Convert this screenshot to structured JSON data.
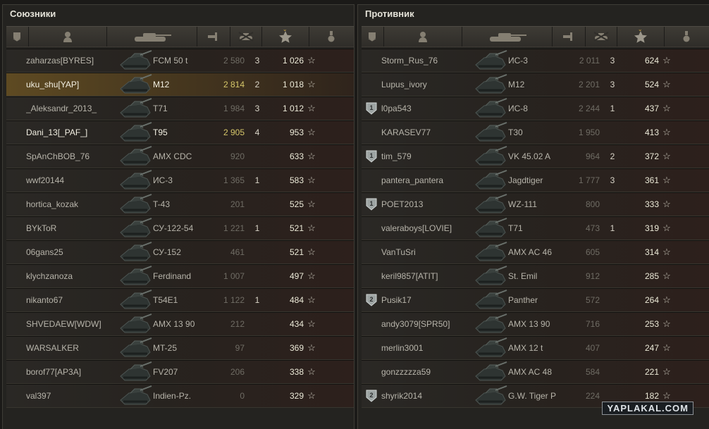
{
  "allies": {
    "title": "Союзники",
    "players": [
      {
        "name": "zaharzas[BYRES]",
        "tank": "FCM 50 t",
        "damage": "2 580",
        "kills": "3",
        "xp": "1 026"
      },
      {
        "name": "uku_shu[YAP]",
        "tank": "M12",
        "damage": "2 814",
        "kills": "2",
        "xp": "1 018"
      },
      {
        "name": "_Aleksandr_2013_",
        "tank": "T71",
        "damage": "1 984",
        "kills": "3",
        "xp": "1 012"
      },
      {
        "name": "Dani_13[_PAF_]",
        "tank": "T95",
        "damage": "2 905",
        "kills": "4",
        "xp": "953"
      },
      {
        "name": "SpAnChBOB_76",
        "tank": "AMX CDC",
        "damage": "920",
        "kills": "",
        "xp": "633"
      },
      {
        "name": "wwf20144",
        "tank": "ИС-3",
        "damage": "1 365",
        "kills": "1",
        "xp": "583"
      },
      {
        "name": "hortica_kozak",
        "tank": "T-43",
        "damage": "201",
        "kills": "",
        "xp": "525"
      },
      {
        "name": "BYkToR",
        "tank": "СУ-122-54",
        "damage": "1 221",
        "kills": "1",
        "xp": "521"
      },
      {
        "name": "06gans25",
        "tank": "СУ-152",
        "damage": "461",
        "kills": "",
        "xp": "521"
      },
      {
        "name": "klychzanoza",
        "tank": "Ferdinand",
        "damage": "1 007",
        "kills": "",
        "xp": "497"
      },
      {
        "name": "nikanto67",
        "tank": "T54E1",
        "damage": "1 122",
        "kills": "1",
        "xp": "484"
      },
      {
        "name": "SHVEDAEW[WDW]",
        "tank": "AMX 13 90",
        "damage": "212",
        "kills": "",
        "xp": "434"
      },
      {
        "name": "WARSALKER",
        "tank": "MT-25",
        "damage": "97",
        "kills": "",
        "xp": "369"
      },
      {
        "name": "borof77[AP3A]",
        "tank": "FV207",
        "damage": "206",
        "kills": "",
        "xp": "338"
      },
      {
        "name": "val397",
        "tank": "Indien-Pz.",
        "damage": "0",
        "kills": "",
        "xp": "329"
      }
    ]
  },
  "enemies": {
    "title": "Противник",
    "players": [
      {
        "name": "Storm_Rus_76",
        "tank": "ИС-3",
        "damage": "2 011",
        "kills": "3",
        "xp": "624"
      },
      {
        "name": "Lupus_ivory",
        "tank": "M12",
        "damage": "2 201",
        "kills": "3",
        "xp": "524"
      },
      {
        "name": "l0pa543",
        "tank": "ИС-8",
        "damage": "2 244",
        "kills": "1",
        "xp": "437",
        "badge": "1"
      },
      {
        "name": "KARASEV77",
        "tank": "T30",
        "damage": "1 950",
        "kills": "",
        "xp": "413"
      },
      {
        "name": "tim_579",
        "tank": "VK 45.02 A",
        "damage": "964",
        "kills": "2",
        "xp": "372",
        "badge": "1"
      },
      {
        "name": "pantera_pantera",
        "tank": "Jagdtiger",
        "damage": "1 777",
        "kills": "3",
        "xp": "361"
      },
      {
        "name": "POET2013",
        "tank": "WZ-111",
        "damage": "800",
        "kills": "",
        "xp": "333",
        "badge": "1"
      },
      {
        "name": "valeraboys[LOVIE]",
        "tank": "T71",
        "damage": "473",
        "kills": "1",
        "xp": "319"
      },
      {
        "name": "VanTuSri",
        "tank": "AMX AC 46",
        "damage": "605",
        "kills": "",
        "xp": "314"
      },
      {
        "name": "keril9857[ATIT]",
        "tank": "St. Emil",
        "damage": "912",
        "kills": "",
        "xp": "285"
      },
      {
        "name": "Pusik17",
        "tank": "Panther",
        "damage": "572",
        "kills": "",
        "xp": "264",
        "badge": "2"
      },
      {
        "name": "andy3079[SPR50]",
        "tank": "AMX 13 90",
        "damage": "716",
        "kills": "",
        "xp": "253"
      },
      {
        "name": "merlin3001",
        "tank": "AMX 12 t",
        "damage": "407",
        "kills": "",
        "xp": "247"
      },
      {
        "name": "gonzzzzza59",
        "tank": "AMX AC 48",
        "damage": "584",
        "kills": "",
        "xp": "221"
      },
      {
        "name": "shyrik2014",
        "tank": "G.W. Tiger P",
        "damage": "224",
        "kills": "",
        "xp": "182",
        "badge": "2"
      }
    ]
  },
  "star_glyph": "☆",
  "sort_indicator": "⌄",
  "watermark": "YAPLAKAL.COM",
  "colors": {
    "highlight_row": "#5e4a22",
    "own_damage": "#d6c76a",
    "accent_sort": "#d1a640"
  }
}
